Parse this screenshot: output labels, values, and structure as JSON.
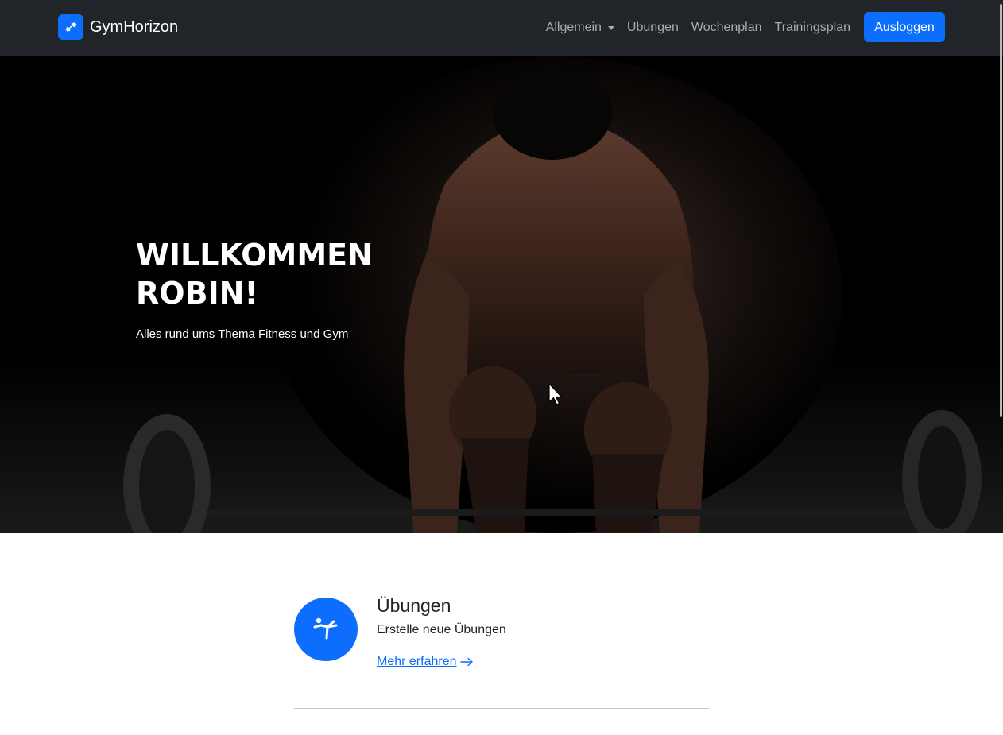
{
  "navbar": {
    "brand": "GymHorizon",
    "items": [
      {
        "label": "Allgemein",
        "dropdown": true
      },
      {
        "label": "Übungen"
      },
      {
        "label": "Wochenplan"
      },
      {
        "label": "Trainingsplan"
      }
    ],
    "logout_label": "Ausloggen"
  },
  "hero": {
    "title": "WILLKOMMEN ROBIN!",
    "subtitle": "Alles rund ums Thema Fitness und Gym"
  },
  "feature": {
    "icon": "exercise-figure-icon",
    "title": "Übungen",
    "description": "Erstelle neue Übungen",
    "link_label": "Mehr erfahren"
  },
  "colors": {
    "navbar_bg": "#212529",
    "accent": "#0d6efd",
    "hero_bg": "#000000",
    "text": "#212529"
  }
}
